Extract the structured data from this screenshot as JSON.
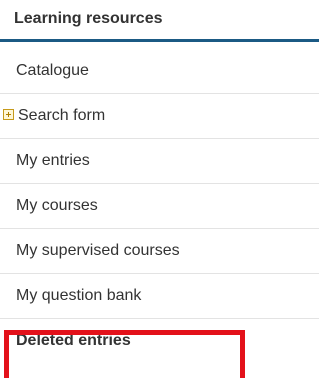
{
  "panel": {
    "title": "Learning resources"
  },
  "menu": {
    "items": [
      {
        "label": "Catalogue"
      },
      {
        "label": "Search form",
        "icon": "expand-plus-icon"
      },
      {
        "label": "My entries"
      },
      {
        "label": "My courses"
      },
      {
        "label": "My supervised courses"
      },
      {
        "label": "My question bank"
      },
      {
        "label": "Deleted entries"
      }
    ]
  },
  "colors": {
    "header_rule": "#1b5a84",
    "highlight_box": "#e3111a",
    "text": "#333333",
    "divider": "#e3e3e3",
    "expand_icon": "#c69a1a"
  }
}
